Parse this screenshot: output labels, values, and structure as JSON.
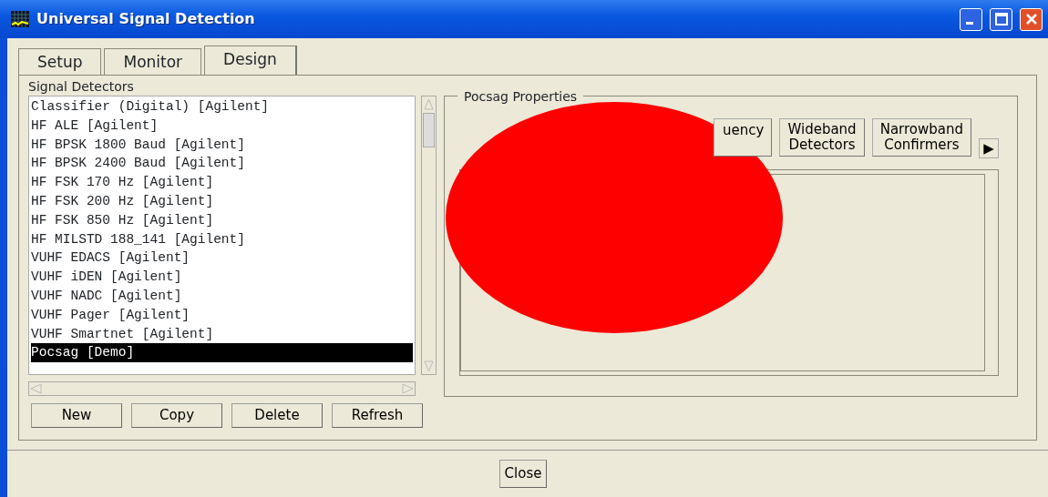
{
  "window": {
    "title": "Universal Signal Detection"
  },
  "tabs": [
    {
      "label": "Setup",
      "selected": false
    },
    {
      "label": "Monitor",
      "selected": false
    },
    {
      "label": "Design",
      "selected": true
    }
  ],
  "detectors": {
    "label": "Signal Detectors",
    "items": [
      {
        "label": "Classifier (Digital) [Agilent]",
        "selected": false
      },
      {
        "label": "HF ALE [Agilent]",
        "selected": false
      },
      {
        "label": "HF BPSK 1800 Baud [Agilent]",
        "selected": false
      },
      {
        "label": "HF BPSK 2400 Baud [Agilent]",
        "selected": false
      },
      {
        "label": "HF FSK 170 Hz [Agilent]",
        "selected": false
      },
      {
        "label": "HF FSK 200 Hz [Agilent]",
        "selected": false
      },
      {
        "label": "HF FSK 850 Hz [Agilent]",
        "selected": false
      },
      {
        "label": "HF MILSTD 188_141 [Agilent]",
        "selected": false
      },
      {
        "label": "VUHF EDACS [Agilent]",
        "selected": false
      },
      {
        "label": "VUHF iDEN [Agilent]",
        "selected": false
      },
      {
        "label": "VUHF NADC [Agilent]",
        "selected": false
      },
      {
        "label": "VUHF Pager [Agilent]",
        "selected": false
      },
      {
        "label": "VUHF Smartnet [Agilent]",
        "selected": false
      },
      {
        "label": "Pocsag [Demo]",
        "selected": true
      }
    ],
    "buttons": [
      "New",
      "Copy",
      "Delete",
      "Refresh"
    ]
  },
  "properties": {
    "title": "Pocsag Properties",
    "tabs": [
      {
        "label": "uency",
        "selected": false
      },
      {
        "label": "Wideband\nDetectors",
        "selected": false
      },
      {
        "label": "Narrowband\nConfirmers",
        "selected": false
      }
    ],
    "scroll_button": "▶"
  },
  "redaction_mark": {
    "kind": "ellipse"
  },
  "footer_button": "Close"
}
